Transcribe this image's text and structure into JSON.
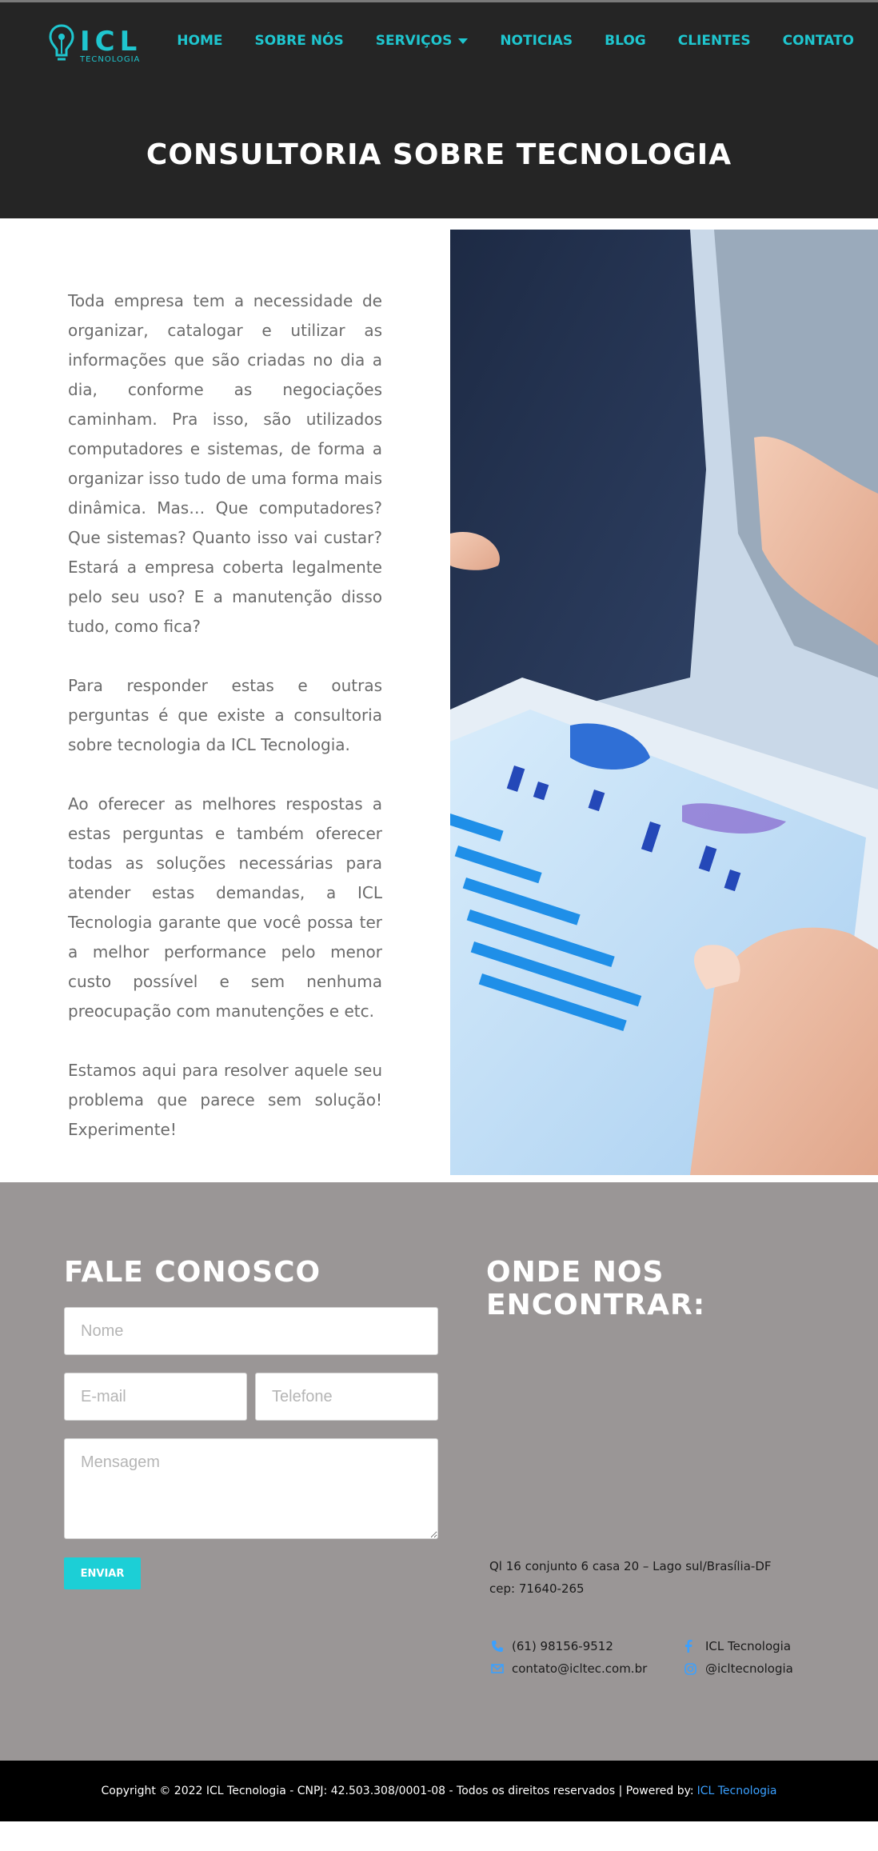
{
  "brand": {
    "logo_text": "ICL",
    "logo_subtext": "TECNOLOGIA",
    "accent_color": "#1fc6cf"
  },
  "nav": {
    "items": [
      {
        "label": "HOME"
      },
      {
        "label": "SOBRE NÓS"
      },
      {
        "label": "SERVIÇOS"
      },
      {
        "label": "NOTICIAS"
      },
      {
        "label": "BLOG"
      },
      {
        "label": "CLIENTES"
      },
      {
        "label": "CONTATO"
      }
    ]
  },
  "page": {
    "title": "CONSULTORIA SOBRE TECNOLOGIA",
    "paragraphs": [
      "Toda empresa tem a necessidade de organizar, catalogar e utilizar as informações que são criadas no dia a dia, conforme as negociações caminham. Pra isso, são utilizados computadores e sistemas, de forma a organizar isso tudo de uma forma mais dinâmica. Mas… Que computadores? Que sistemas? Quanto isso vai custar? Estará a empresa coberta legalmente pelo seu uso? E a manutenção disso tudo, como fica?",
      "Para responder estas e outras perguntas é que existe a consultoria sobre tecnologia da ICL Tecnologia.",
      "Ao oferecer as melhores respostas a estas perguntas e também oferecer todas as soluções necessárias para atender estas demandas, a ICL Tecnologia garante que você possa ter a melhor performance  pelo menor custo possível e sem nenhuma preocupação com manutenções e etc.",
      "Estamos aqui para resolver aquele seu problema que parece sem solução! Experimente!"
    ]
  },
  "contact_form": {
    "title": "FALE CONOSCO",
    "name_placeholder": "Nome",
    "email_placeholder": "E-mail",
    "phone_placeholder": "Telefone",
    "message_placeholder": "Mensagem",
    "submit_label": "ENVIAR"
  },
  "location": {
    "title": "ONDE NOS ENCONTRAR:",
    "address_line1": "Ql 16 conjunto 6 casa 20 – Lago sul/Brasília-DF",
    "address_line2": "cep: 71640-265",
    "phone": "(61) 98156-9512",
    "email": "contato@icltec.com.br",
    "facebook": "ICL Tecnologia",
    "instagram": "@icltecnologia"
  },
  "footer": {
    "text": "Copyright © 2022 ICL Tecnologia - CNPJ: 42.503.308/0001-08 - Todos os direitos reservados | Powered by:",
    "link_label": "ICL Tecnologia",
    "link_color": "#3aa0ff"
  }
}
